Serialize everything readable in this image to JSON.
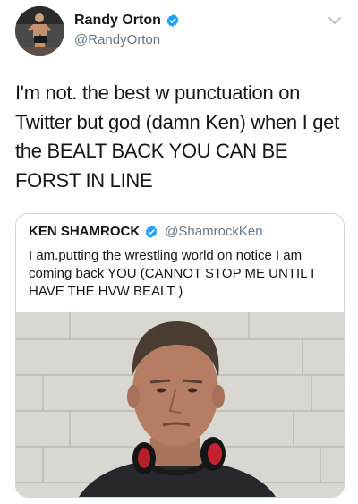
{
  "tweet": {
    "display_name": "Randy Orton",
    "handle": "@RandyOrton",
    "text": "I'm not. the best w punctuation on Twitter but god (damn Ken) when I get the BEALT BACK YOU CAN BE FORST IN LINE",
    "verified": true,
    "icons": {
      "verified": "verified-badge-icon",
      "caret": "chevron-down-icon"
    }
  },
  "quoted_tweet": {
    "display_name": "KEN SHAMROCK",
    "handle": "@ShamrockKen",
    "text": "I am.putting the wrestling world on notice I am coming back YOU (CANNOT STOP ME UNTIL I HAVE THE HVW BEALT )",
    "verified": true
  },
  "colors": {
    "text": "#14171a",
    "secondary": "#657786",
    "verified_blue": "#1da1f2",
    "border": "#ccd6dd"
  }
}
